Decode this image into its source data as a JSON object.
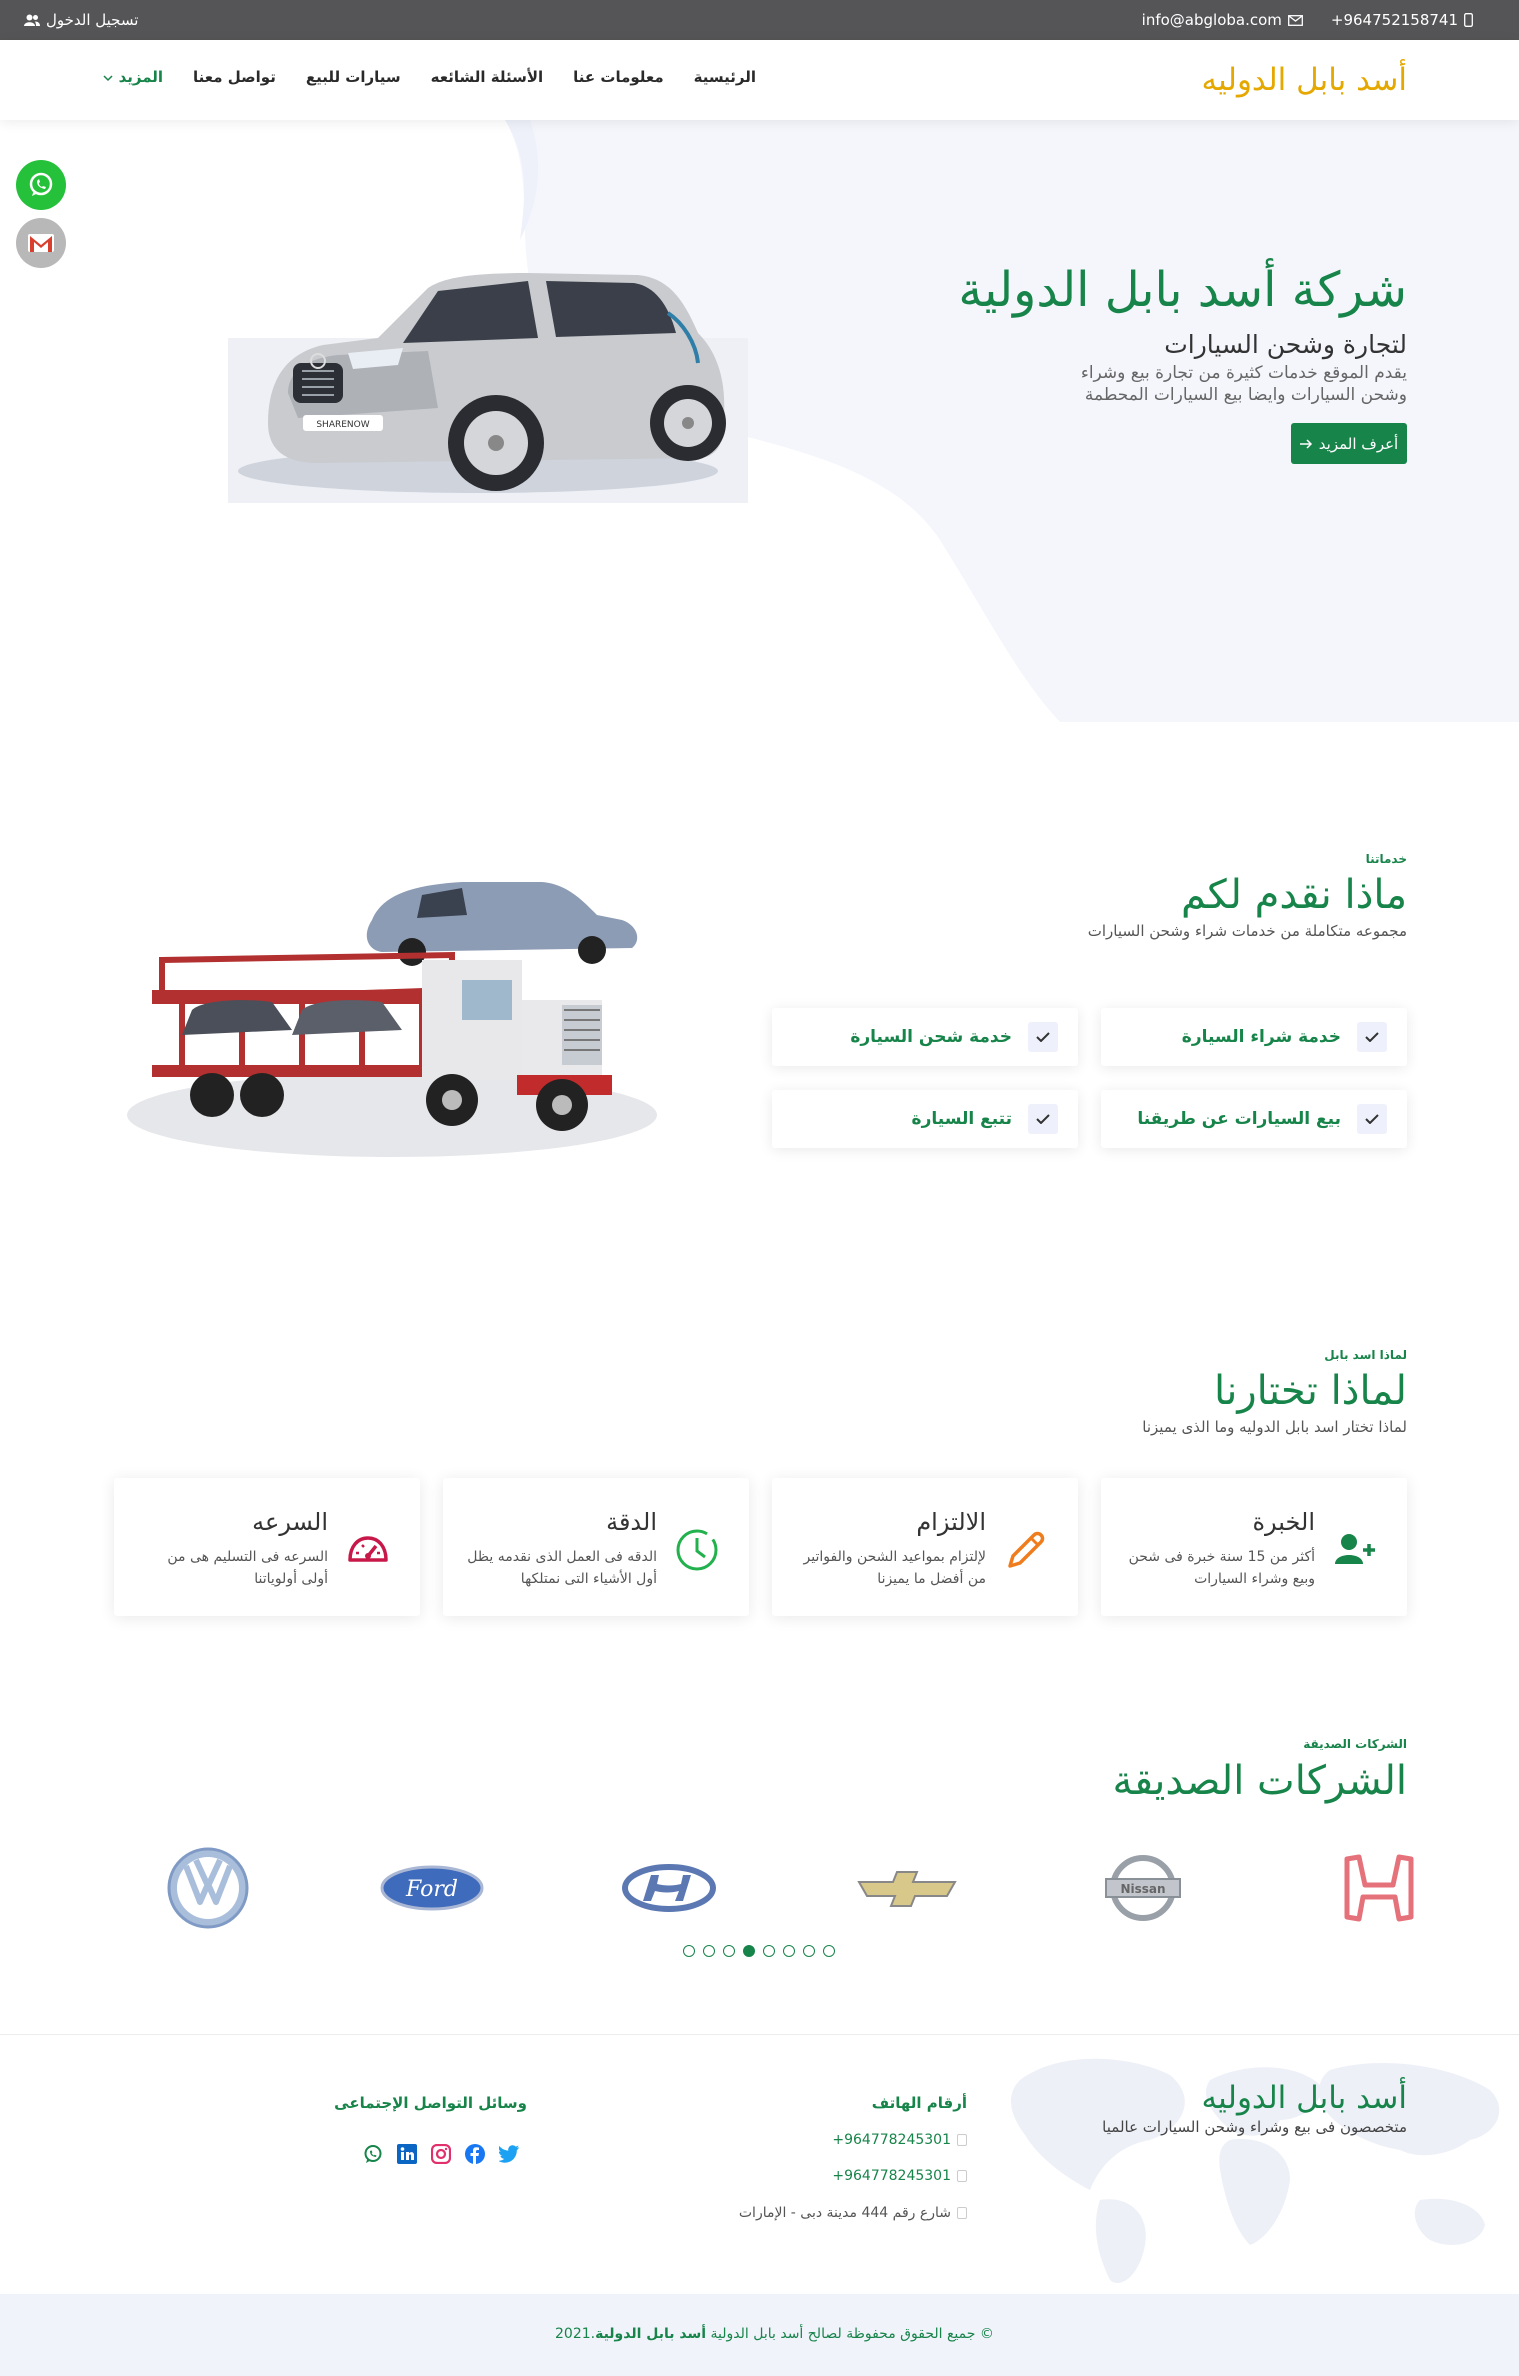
{
  "topbar": {
    "phone": "+964752158741",
    "email": "info@abgloba.com",
    "login": "تسجيل الدخول"
  },
  "nav": {
    "logo": "أسد بابل الدوليه",
    "items": [
      "الرئيسية",
      "معلومات عنا",
      "الأسئلة الشائعه",
      "سيارات للبيع",
      "تواصل معنا",
      "المزيد"
    ]
  },
  "hero": {
    "title": "شركة أسد بابل الدولية",
    "subtitle": "لتجارة وشحن السيارات",
    "description": "يقدم الموقع خدمات كثيرة من تجارة بيع وشراء وشحن السيارات وايضا بيع السيارات المحطمة",
    "button": "أعرف المزيد",
    "car_plate": "SHARENOW"
  },
  "services": {
    "label": "خدماتنا",
    "title": "ماذا نقدم لكم",
    "subtitle": "مجموعه متكاملة من خدمات شراء وشحن السيارات",
    "items": [
      "خدمة شراء السيارة",
      "خدمة شحن السيارة",
      "بيع السيارات عن طريقنا",
      "تتبع السيارة"
    ]
  },
  "why": {
    "label": "لماذا اسد بابل",
    "title": "لماذا تختارنا",
    "subtitle": "لماذا تختار اسد بابل الدوليه وما الذى يميزنا",
    "cards": [
      {
        "title": "الخبرة",
        "desc": "أكثر من 15 سنة خبرة فى شحن وبيع وشراء السيارات",
        "icon": "user-plus-icon",
        "color": "#17844a"
      },
      {
        "title": "الالتزام",
        "desc": "لإلتزام بمواعيد الشحن والفواتير من أفضل ما يميزنا",
        "icon": "pencil-icon",
        "color": "#f07d1d"
      },
      {
        "title": "الدقة",
        "desc": "الدقه فى العمل الذى نقدمه يظل أول الأشياء التى نمتلكها",
        "icon": "clock-icon",
        "color": "#22b14c"
      },
      {
        "title": "السرعه",
        "desc": "السرعه فى التسليم هى من أولى أولوياتنا",
        "icon": "speedometer-icon",
        "color": "#c8184a"
      }
    ]
  },
  "partners": {
    "label": "الشركات الصديقة",
    "title": "الشركات الصديقة",
    "brands": [
      "Honda",
      "Nissan",
      "Chevrolet",
      "Hyundai",
      "Ford",
      "Volkswagen"
    ],
    "carousel_active": 4,
    "carousel_count": 8
  },
  "footer": {
    "brand": "أسد بابل الدوليه",
    "tagline": "متخصصون فى بيع وشراء وشحن السيارات عالميا",
    "phones_title": "أرقام الهاتف",
    "phones": [
      "+964778245301",
      "+964778245301"
    ],
    "address": "شارع رقم 444 مدينة دبى - الإمارات",
    "social_title": "وسائل التواصل الإجتماعى",
    "socials": [
      "twitter-icon",
      "facebook-icon",
      "instagram-icon",
      "linkedin-icon",
      "whatsapp-icon"
    ],
    "copyright_prefix": "© جميع الحقوق محفوظة لصالح أسد بابل الدولية",
    "copyright_brand": "أسد بابل الدولية",
    "copyright_year": ".2021"
  }
}
